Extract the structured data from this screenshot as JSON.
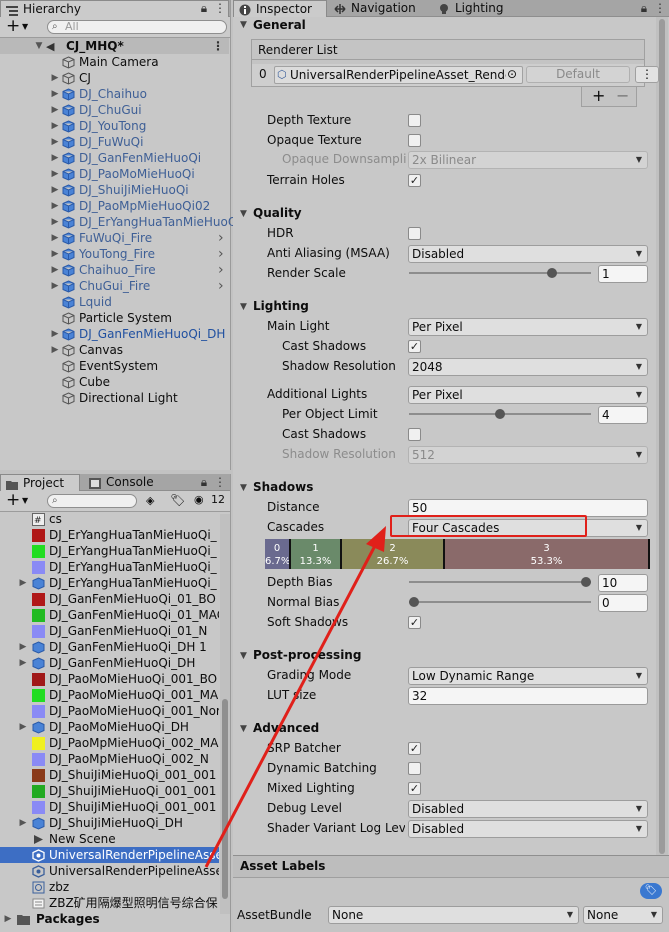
{
  "hierarchy": {
    "tab": "Hierarchy",
    "search_placeholder": "All",
    "scene": "CJ_MHQ*",
    "items": [
      {
        "label": "Main Camera",
        "prefab": false,
        "arrow": false,
        "indent": 1
      },
      {
        "label": "CJ",
        "prefab": false,
        "arrow": true,
        "indent": 1
      },
      {
        "label": "DJ_Chaihuo",
        "prefab": true,
        "arrow": true,
        "indent": 1
      },
      {
        "label": "DJ_ChuGui",
        "prefab": true,
        "arrow": true,
        "indent": 1
      },
      {
        "label": "DJ_YouTong",
        "prefab": true,
        "arrow": true,
        "indent": 1
      },
      {
        "label": "DJ_FuWuQi",
        "prefab": true,
        "arrow": true,
        "indent": 1
      },
      {
        "label": "DJ_GanFenMieHuoQi",
        "prefab": true,
        "arrow": true,
        "indent": 1
      },
      {
        "label": "DJ_PaoMoMieHuoQi",
        "prefab": true,
        "arrow": true,
        "indent": 1
      },
      {
        "label": "DJ_ShuiJiMieHuoQi",
        "prefab": true,
        "arrow": true,
        "indent": 1
      },
      {
        "label": "DJ_PaoMpMieHuoQi02",
        "prefab": true,
        "arrow": true,
        "indent": 1
      },
      {
        "label": "DJ_ErYangHuaTanMieHuoQ",
        "prefab": true,
        "arrow": true,
        "indent": 1
      },
      {
        "label": "FuWuQi_Fire",
        "prefab": true,
        "arrow": true,
        "indent": 1,
        "chev": true
      },
      {
        "label": "YouTong_Fire",
        "prefab": true,
        "arrow": true,
        "indent": 1,
        "chev": true
      },
      {
        "label": "Chaihuo_Fire",
        "prefab": true,
        "arrow": true,
        "indent": 1,
        "chev": true
      },
      {
        "label": "ChuGui_Fire",
        "prefab": true,
        "arrow": true,
        "indent": 1,
        "chev": true
      },
      {
        "label": "Lquid",
        "prefab": true,
        "arrow": false,
        "indent": 1
      },
      {
        "label": "Particle System",
        "prefab": false,
        "arrow": false,
        "indent": 1
      },
      {
        "label": "DJ_GanFenMieHuoQi_DH",
        "prefab": true,
        "arrow": true,
        "indent": 1,
        "strong": true
      },
      {
        "label": "Canvas",
        "prefab": false,
        "arrow": true,
        "indent": 1
      },
      {
        "label": "EventSystem",
        "prefab": false,
        "arrow": false,
        "indent": 1
      },
      {
        "label": "Cube",
        "prefab": false,
        "arrow": false,
        "indent": 1
      },
      {
        "label": "Directional Light",
        "prefab": false,
        "arrow": false,
        "indent": 1
      }
    ]
  },
  "project": {
    "tabs": [
      "Project",
      "Console"
    ],
    "hidden_count": "12",
    "items": [
      {
        "label": "cs",
        "icon": "script",
        "arrow": false
      },
      {
        "label": "DJ_ErYangHuaTanMieHuoQi_",
        "icon": "#b01818",
        "arrow": false
      },
      {
        "label": "DJ_ErYangHuaTanMieHuoQi_",
        "icon": "#22dd22",
        "arrow": false
      },
      {
        "label": "DJ_ErYangHuaTanMieHuoQi_",
        "icon": "#8a8af5",
        "arrow": false
      },
      {
        "label": "DJ_ErYangHuaTanMieHuoQi_",
        "icon": "prefab",
        "arrow": true
      },
      {
        "label": "DJ_GanFenMieHuoQi_01_BO",
        "icon": "#b01818",
        "arrow": false
      },
      {
        "label": "DJ_GanFenMieHuoQi_01_MAC",
        "icon": "#22bb22",
        "arrow": false
      },
      {
        "label": "DJ_GanFenMieHuoQi_01_N",
        "icon": "#8a8af5",
        "arrow": false
      },
      {
        "label": "DJ_GanFenMieHuoQi_DH 1",
        "icon": "prefab",
        "arrow": true
      },
      {
        "label": "DJ_GanFenMieHuoQi_DH",
        "icon": "prefab",
        "arrow": true
      },
      {
        "label": "DJ_PaoMoMieHuoQi_001_BO",
        "icon": "#a01818",
        "arrow": false
      },
      {
        "label": "DJ_PaoMoMieHuoQi_001_MA",
        "icon": "#22dd22",
        "arrow": false
      },
      {
        "label": "DJ_PaoMoMieHuoQi_001_Nor",
        "icon": "#8a8af5",
        "arrow": false
      },
      {
        "label": "DJ_PaoMoMieHuoQi_DH",
        "icon": "prefab",
        "arrow": true
      },
      {
        "label": "DJ_PaoMpMieHuoQi_002_MA",
        "icon": "#f0f020",
        "arrow": false
      },
      {
        "label": "DJ_PaoMpMieHuoQi_002_N",
        "icon": "#8a8af5",
        "arrow": false
      },
      {
        "label": "DJ_ShuiJiMieHuoQi_001_001",
        "icon": "#8a3a1a",
        "arrow": false
      },
      {
        "label": "DJ_ShuiJiMieHuoQi_001_001",
        "icon": "#22aa22",
        "arrow": false
      },
      {
        "label": "DJ_ShuiJiMieHuoQi_001_001",
        "icon": "#8a8af5",
        "arrow": false
      },
      {
        "label": "DJ_ShuiJiMieHuoQi_DH",
        "icon": "prefab",
        "arrow": true
      },
      {
        "label": "New Scene",
        "icon": "scene",
        "arrow": false
      },
      {
        "label": "UniversalRenderPipelineAsset",
        "icon": "asset",
        "arrow": false,
        "selected": true
      },
      {
        "label": "UniversalRenderPipelineAsset",
        "icon": "asset",
        "arrow": false
      },
      {
        "label": "zbz",
        "icon": "asset2",
        "arrow": false
      },
      {
        "label": "ZBZ矿用隔爆型照明信号综合保",
        "icon": "text",
        "arrow": false
      }
    ],
    "packages": "Packages"
  },
  "inspector": {
    "tabs": [
      "Inspector",
      "Navigation",
      "Lighting"
    ],
    "general": {
      "title": "General",
      "renderer_list": "Renderer List",
      "renderer_index": "0",
      "renderer_asset": "UniversalRenderPipelineAsset_Renderer",
      "renderer_default": "Default",
      "plus": "+",
      "minus": "−",
      "depth_texture": "Depth Texture",
      "opaque_texture": "Opaque Texture",
      "opaque_downsampling": "Opaque Downsampling",
      "opaque_downsampling_value": "2x Bilinear",
      "terrain_holes": "Terrain Holes"
    },
    "quality": {
      "title": "Quality",
      "hdr": "HDR",
      "anti_aliasing": "Anti Aliasing (MSAA)",
      "anti_aliasing_value": "Disabled",
      "render_scale": "Render Scale",
      "render_scale_value": "1",
      "render_scale_fraction": 0.8
    },
    "lighting": {
      "title": "Lighting",
      "main_light": "Main Light",
      "main_light_value": "Per Pixel",
      "cast_shadows": "Cast Shadows",
      "shadow_resolution": "Shadow Resolution",
      "shadow_resolution_value": "2048",
      "additional_lights": "Additional Lights",
      "additional_lights_value": "Per Pixel",
      "per_object_limit": "Per Object Limit",
      "per_object_limit_value": "4",
      "per_object_limit_fraction": 0.5,
      "add_cast_shadows": "Cast Shadows",
      "add_shadow_resolution": "Shadow Resolution",
      "add_shadow_resolution_value": "512"
    },
    "shadows": {
      "title": "Shadows",
      "distance": "Distance",
      "distance_value": "50",
      "cascades": "Cascades",
      "cascades_value": "Four Cascades",
      "cascade_segments": [
        {
          "index": "0",
          "pct": "6.7%",
          "frac": 0.067,
          "color": "#6a6a8f"
        },
        {
          "index": "1",
          "pct": "13.3%",
          "frac": 0.133,
          "color": "#6a8a6a"
        },
        {
          "index": "2",
          "pct": "26.7%",
          "frac": 0.267,
          "color": "#8a8a5a"
        },
        {
          "index": "3",
          "pct": "53.3%",
          "frac": 0.533,
          "color": "#8a6a6a"
        }
      ],
      "depth_bias": "Depth Bias",
      "depth_bias_value": "10",
      "depth_bias_fraction": 1.0,
      "normal_bias": "Normal Bias",
      "normal_bias_value": "0",
      "normal_bias_fraction": 0.0,
      "soft_shadows": "Soft Shadows"
    },
    "post": {
      "title": "Post-processing",
      "grading_mode": "Grading Mode",
      "grading_mode_value": "Low Dynamic Range",
      "lut_size": "LUT size",
      "lut_size_value": "32"
    },
    "advanced": {
      "title": "Advanced",
      "srp_batcher": "SRP Batcher",
      "dynamic_batching": "Dynamic Batching",
      "mixed_lighting": "Mixed Lighting",
      "debug_level": "Debug Level",
      "debug_level_value": "Disabled",
      "shader_variant": "Shader Variant Log Level",
      "shader_variant_value": "Disabled"
    },
    "asset_labels": "Asset Labels",
    "asset_bundle": "AssetBundle",
    "asset_bundle_value": "None",
    "asset_bundle_variant": "None"
  },
  "colors": {
    "highlight": "#e0201a",
    "selection": "#3d6ec4",
    "prefab_text": "#3e5f96"
  }
}
